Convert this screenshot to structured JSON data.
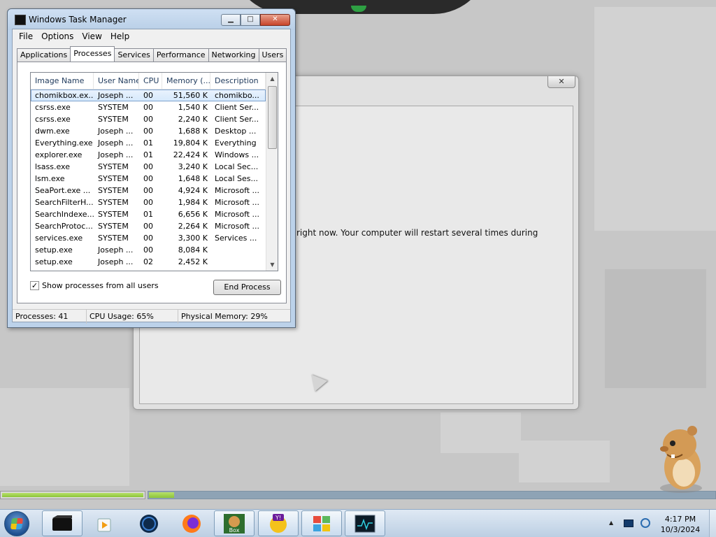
{
  "setup_window": {
    "close_label": "✕",
    "message": "right now. Your computer will restart several times during"
  },
  "task_manager": {
    "title": "Windows Task Manager",
    "buttons": {
      "minimize": "▁",
      "maximize": "□",
      "close": "✕"
    },
    "menu": [
      "File",
      "Options",
      "View",
      "Help"
    ],
    "tabs": [
      "Applications",
      "Processes",
      "Services",
      "Performance",
      "Networking",
      "Users"
    ],
    "active_tab": "Processes",
    "columns": [
      "Image Name",
      "User Name",
      "CPU",
      "Memory (...",
      "Description"
    ],
    "processes": [
      [
        "chomikbox.ex...",
        "Joseph ...",
        "00",
        "51,560 K",
        "chomikbo..."
      ],
      [
        "csrss.exe",
        "SYSTEM",
        "00",
        "1,540 K",
        "Client Ser..."
      ],
      [
        "csrss.exe",
        "SYSTEM",
        "00",
        "2,240 K",
        "Client Ser..."
      ],
      [
        "dwm.exe",
        "Joseph ...",
        "00",
        "1,688 K",
        "Desktop ..."
      ],
      [
        "Everything.exe",
        "Joseph ...",
        "01",
        "19,804 K",
        "Everything"
      ],
      [
        "explorer.exe",
        "Joseph ...",
        "01",
        "22,424 K",
        "Windows ..."
      ],
      [
        "lsass.exe",
        "SYSTEM",
        "00",
        "3,240 K",
        "Local Sec..."
      ],
      [
        "lsm.exe",
        "SYSTEM",
        "00",
        "1,648 K",
        "Local Ses..."
      ],
      [
        "SeaPort.exe ...",
        "SYSTEM",
        "00",
        "4,924 K",
        "Microsoft ..."
      ],
      [
        "SearchFilterH...",
        "SYSTEM",
        "00",
        "1,984 K",
        "Microsoft ..."
      ],
      [
        "SearchIndexe...",
        "SYSTEM",
        "01",
        "6,656 K",
        "Microsoft ..."
      ],
      [
        "SearchProtoc...",
        "SYSTEM",
        "00",
        "2,264 K",
        "Microsoft ..."
      ],
      [
        "services.exe",
        "SYSTEM",
        "00",
        "3,300 K",
        "Services ..."
      ],
      [
        "setup.exe",
        "Joseph ...",
        "00",
        "8,084 K",
        ""
      ],
      [
        "setup.exe",
        "Joseph ...",
        "02",
        "2,452 K",
        ""
      ]
    ],
    "show_all_label": "Show processes from all users",
    "show_all_checked": "✓",
    "end_process_label": "End Process",
    "status": {
      "processes": "Processes: 41",
      "cpu": "CPU Usage: 65%",
      "memory": "Physical Memory: 29%"
    }
  },
  "taskbar": {
    "time": "4:17 PM",
    "date": "10/3/2024",
    "tray_chevron": "▲"
  },
  "icons": {
    "yahoo_label": "Y!",
    "box_label": "Box"
  }
}
